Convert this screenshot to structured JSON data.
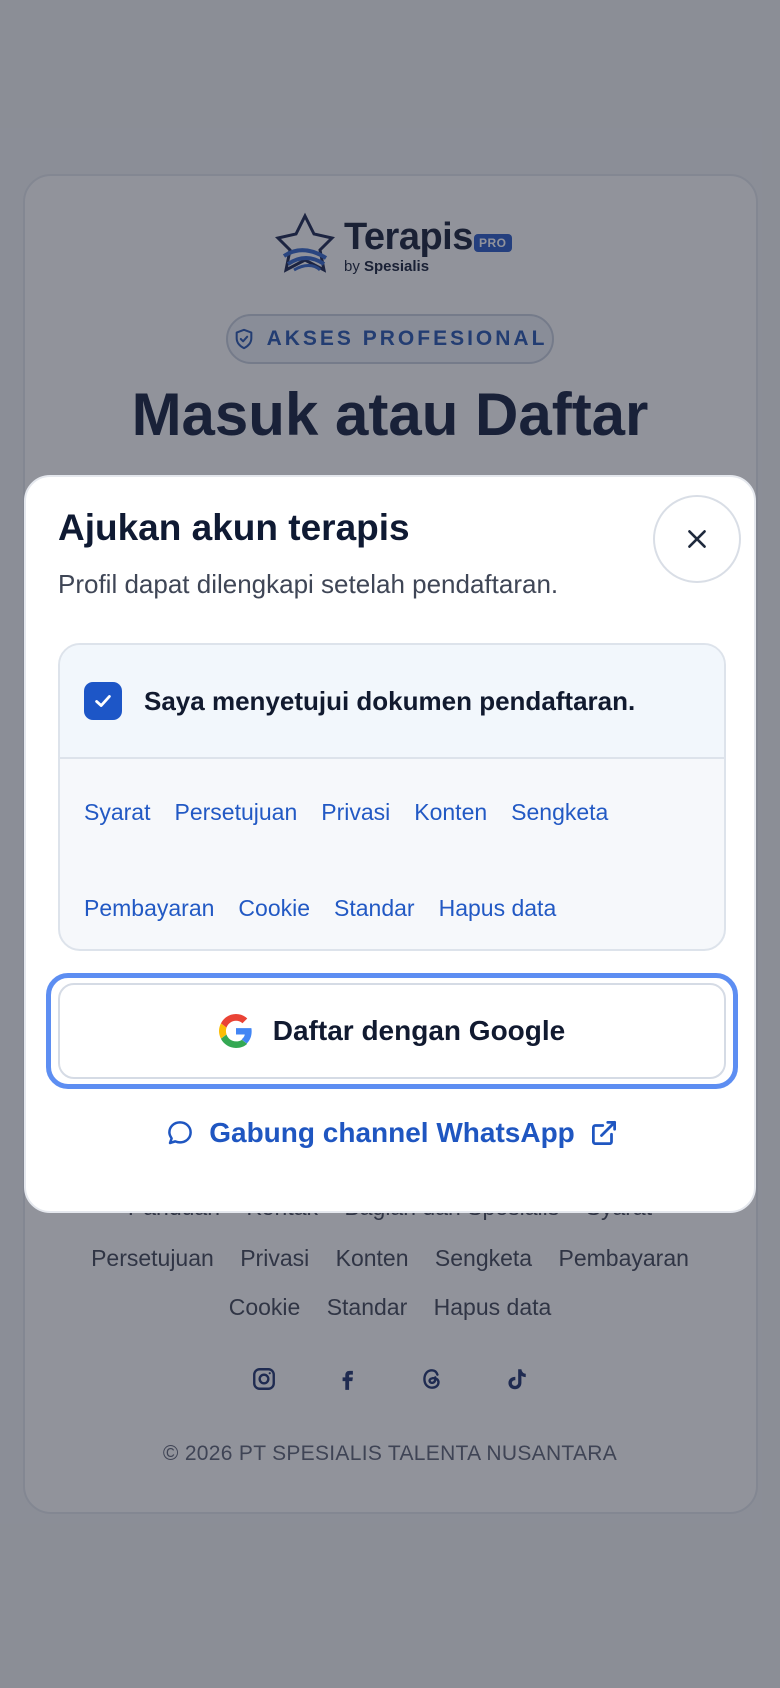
{
  "brand": {
    "name": "Terapis",
    "pro_badge": "PRO",
    "by_prefix": "by",
    "by_name": "Spesialis",
    "accent": "#2457c5"
  },
  "background": {
    "badge": "AKSES PROFESIONAL",
    "title": "Masuk atau Daftar",
    "footer_row1": [
      "Panduan",
      "Kontak",
      "Bagian dan Spesialis",
      "Syarat"
    ],
    "footer_row2": [
      "Persetujuan",
      "Privasi",
      "Konten",
      "Sengketa",
      "Pembayaran"
    ],
    "footer_row3": [
      "Cookie",
      "Standar",
      "Hapus data"
    ],
    "socials": [
      "instagram-icon",
      "facebook-icon",
      "threads-icon",
      "tiktok-icon"
    ],
    "copyright": "© 2026 PT SPESIALIS TALENTA NUSANTARA"
  },
  "modal": {
    "title": "Ajukan akun terapis",
    "subtitle": "Profil dapat dilengkapi setelah pendaftaran.",
    "close_icon": "close-icon",
    "consent": {
      "checked": true,
      "label": "Saya menyetujui dokumen pendaftaran."
    },
    "doc_links_row1": [
      "Syarat",
      "Persetujuan",
      "Privasi",
      "Konten",
      "Sengketa"
    ],
    "doc_links_row2": [
      "Pembayaran",
      "Cookie",
      "Standar",
      "Hapus data"
    ],
    "google_button": "Daftar dengan Google",
    "whatsapp_link": "Gabung channel WhatsApp"
  }
}
